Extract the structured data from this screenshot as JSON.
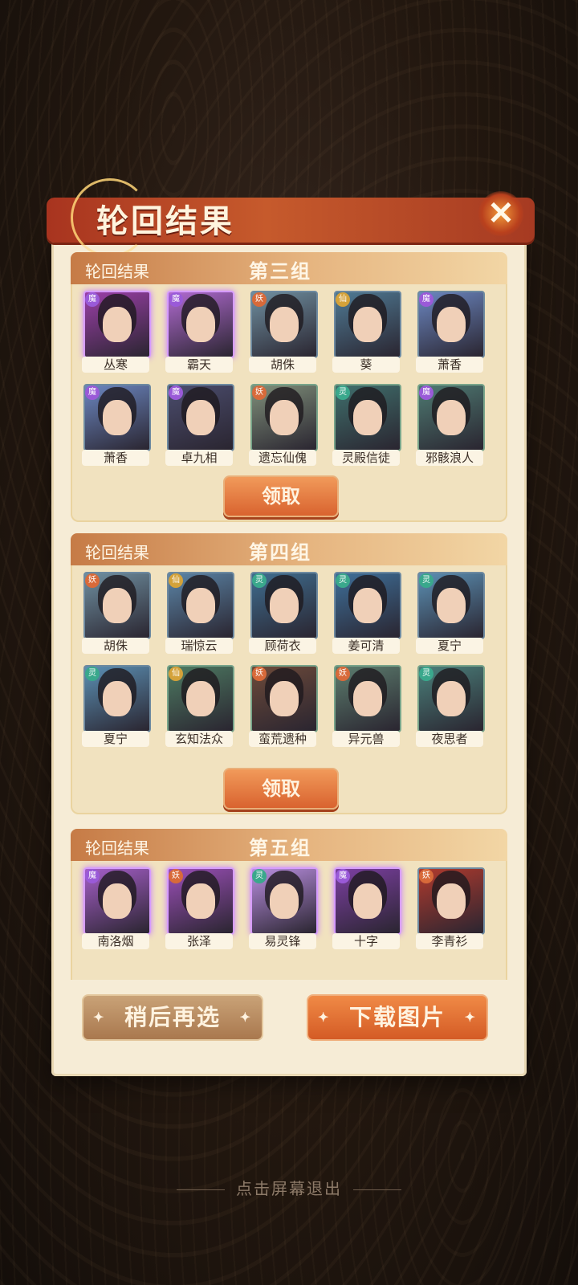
{
  "dialog": {
    "title": "轮回结果",
    "close_glyph": "✕"
  },
  "groups": [
    {
      "label": "轮回结果",
      "name": "第三组",
      "claim_label": "领取",
      "cards": [
        {
          "name": "丛寒",
          "badge": "魔",
          "frame": "purple",
          "color": "#9b3fa8"
        },
        {
          "name": "霸天",
          "badge": "魔",
          "frame": "purple",
          "color": "#b06ad0"
        },
        {
          "name": "胡侏",
          "badge": "妖",
          "frame": "blue",
          "color": "#6f8fa0"
        },
        {
          "name": "葵",
          "badge": "仙",
          "frame": "blue",
          "color": "#4f7a94"
        },
        {
          "name": "萧香",
          "badge": "魔",
          "frame": "blue",
          "color": "#6b86c0"
        },
        {
          "name": "萧香",
          "badge": "魔",
          "frame": "blue",
          "color": "#6b86c0"
        },
        {
          "name": "卓九相",
          "badge": "魔",
          "frame": "blue",
          "color": "#4b4d6e"
        },
        {
          "name": "遗忘仙傀",
          "badge": "妖",
          "frame": "green",
          "color": "#7f8f7a"
        },
        {
          "name": "灵殿信徒",
          "badge": "灵",
          "frame": "green",
          "color": "#3f6f6c"
        },
        {
          "name": "邪骸浪人",
          "badge": "魔",
          "frame": "green",
          "color": "#4e7a72"
        }
      ]
    },
    {
      "label": "轮回结果",
      "name": "第四组",
      "claim_label": "领取",
      "cards": [
        {
          "name": "胡侏",
          "badge": "妖",
          "frame": "blue",
          "color": "#6f8fa0"
        },
        {
          "name": "瑞惊云",
          "badge": "仙",
          "frame": "blue",
          "color": "#5b84a6"
        },
        {
          "name": "顾荷衣",
          "badge": "灵",
          "frame": "blue",
          "color": "#3f6d8f"
        },
        {
          "name": "姜可清",
          "badge": "灵",
          "frame": "blue",
          "color": "#3e6f99"
        },
        {
          "name": "夏宁",
          "badge": "灵",
          "frame": "blue",
          "color": "#5b8fb3"
        },
        {
          "name": "夏宁",
          "badge": "灵",
          "frame": "blue",
          "color": "#5b8fb3"
        },
        {
          "name": "玄知法众",
          "badge": "仙",
          "frame": "green",
          "color": "#4d7a62"
        },
        {
          "name": "蛮荒遗种",
          "badge": "妖",
          "frame": "green",
          "color": "#6d4a3a"
        },
        {
          "name": "异元兽",
          "badge": "妖",
          "frame": "green",
          "color": "#5c7d6e"
        },
        {
          "name": "夜思者",
          "badge": "灵",
          "frame": "green",
          "color": "#4a7f7a"
        }
      ]
    },
    {
      "label": "轮回结果",
      "name": "第五组",
      "claim_label": "",
      "cards": [
        {
          "name": "南洛烟",
          "badge": "魔",
          "frame": "purple",
          "color": "#a55ec8"
        },
        {
          "name": "张泽",
          "badge": "妖",
          "frame": "purple",
          "color": "#9b4fb8"
        },
        {
          "name": "易灵锋",
          "badge": "灵",
          "frame": "purple",
          "color": "#b98ee0"
        },
        {
          "name": "十字",
          "badge": "魔",
          "frame": "purple",
          "color": "#7c3fa2"
        },
        {
          "name": "李青衫",
          "badge": "妖",
          "frame": "blue",
          "color": "#b03a2e"
        }
      ]
    }
  ],
  "buttons": {
    "later": "稍后再选",
    "download": "下载图片"
  },
  "exit_hint": "点击屏幕退出",
  "colors": {
    "badge_mo": "#9a5ad8",
    "badge_yao": "#d86a3a",
    "badge_xian": "#d4a23a",
    "badge_ling": "#3aa88c"
  }
}
